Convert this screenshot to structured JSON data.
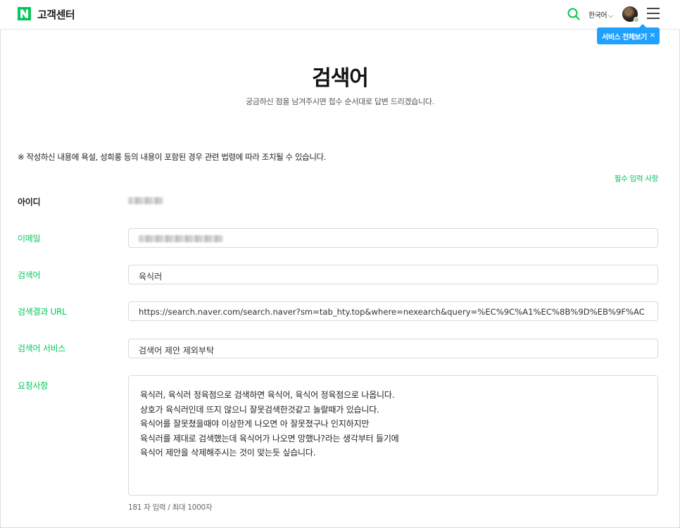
{
  "header": {
    "brand_title": "고객센터",
    "language": "한국어",
    "icons": [
      "naver-logo-icon",
      "search-icon",
      "chevron-down-icon",
      "avatar",
      "menu-icon"
    ]
  },
  "tooltip": {
    "label": "서비스 전체보기",
    "close": "×"
  },
  "page": {
    "title": "검색어",
    "subtitle": "궁금하신 점을 남겨주시면 접수 순서대로 답변 드리겠습니다.",
    "notice": "※ 작성하신 내용에 욕설, 성희롱 등의 내용이 포함된 경우 관련 법령에 따라 조치될 수 있습니다.",
    "required_note": "필수 입력 사항"
  },
  "form": {
    "id_label": "아이디",
    "email_label": "이메일",
    "keyword_label": "검색어",
    "keyword_value": "육식러",
    "url_label": "검색결과 URL",
    "url_value": "https://search.naver.com/search.naver?sm=tab_hty.top&where=nexearch&query=%EC%9C%A1%EC%8B%9D%EB%9F%AC",
    "service_label": "검색어 서비스",
    "service_value": "검색어 제안 제외부탁",
    "request_label": "요청사항",
    "request_lines": [
      "육식러, 육식러 정육점으로 검색하면 육식어, 육식어 정육점으로 나옵니다.",
      "상호가 육식러인데 뜨지 않으니 잘못검색한것같고 놀랄때가 있습니다.",
      "육식어를 잘못쳤을때야 이상한게 나오면 아 잘못쳤구나 인지하지만",
      "육식러를 제대로 검색했는데 육식어가 나오면 망했나?라는 생각부터 들기에",
      "육식어 제안을 삭제해주시는 것이 맞는듯 싶습니다."
    ],
    "counter": "181 자 입력 / 최대 1000자"
  },
  "colors": {
    "accent_green": "#03c75a",
    "tooltip_blue": "#1fa1ff"
  }
}
